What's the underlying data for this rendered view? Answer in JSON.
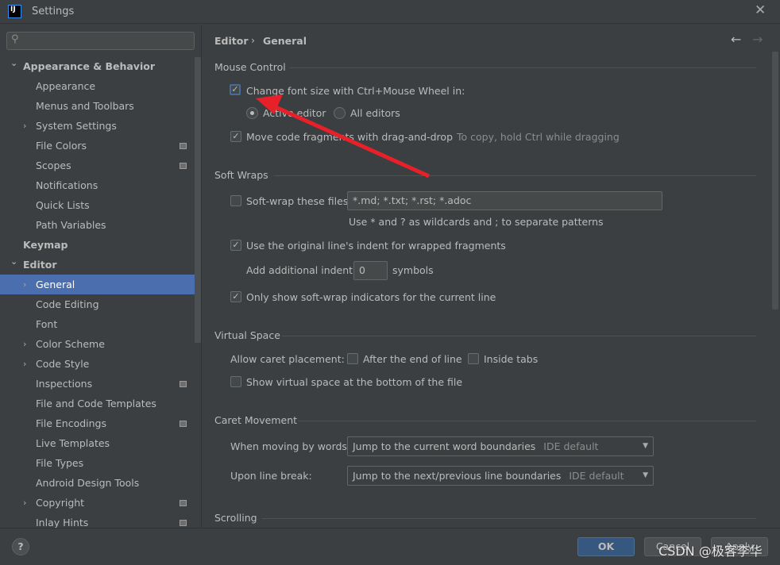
{
  "window": {
    "title": "Settings",
    "logo": "IJ",
    "close_icon": "close-icon"
  },
  "sidebar": {
    "search_placeholder": "",
    "items": [
      {
        "label": "Appearance & Behavior",
        "level": 0,
        "bold": true,
        "expanded": true
      },
      {
        "label": "Appearance",
        "level": 1
      },
      {
        "label": "Menus and Toolbars",
        "level": 1
      },
      {
        "label": "System Settings",
        "level": 1,
        "collapsed": true
      },
      {
        "label": "File Colors",
        "level": 1,
        "project_icon": true
      },
      {
        "label": "Scopes",
        "level": 1,
        "project_icon": true
      },
      {
        "label": "Notifications",
        "level": 1
      },
      {
        "label": "Quick Lists",
        "level": 1
      },
      {
        "label": "Path Variables",
        "level": 1
      },
      {
        "label": "Keymap",
        "level": 0,
        "bold": true
      },
      {
        "label": "Editor",
        "level": 0,
        "bold": true,
        "expanded": true
      },
      {
        "label": "General",
        "level": 1,
        "collapsed": true,
        "selected": true
      },
      {
        "label": "Code Editing",
        "level": 1
      },
      {
        "label": "Font",
        "level": 1
      },
      {
        "label": "Color Scheme",
        "level": 1,
        "collapsed": true
      },
      {
        "label": "Code Style",
        "level": 1,
        "collapsed": true
      },
      {
        "label": "Inspections",
        "level": 1,
        "project_icon": true
      },
      {
        "label": "File and Code Templates",
        "level": 1
      },
      {
        "label": "File Encodings",
        "level": 1,
        "project_icon": true
      },
      {
        "label": "Live Templates",
        "level": 1
      },
      {
        "label": "File Types",
        "level": 1
      },
      {
        "label": "Android Design Tools",
        "level": 1
      },
      {
        "label": "Copyright",
        "level": 1,
        "collapsed": true,
        "project_icon": true
      },
      {
        "label": "Inlay Hints",
        "level": 1,
        "project_icon": true
      }
    ]
  },
  "breadcrumb": {
    "parent": "Editor",
    "sep": "›",
    "current": "General",
    "back": "←",
    "forward": "→"
  },
  "mouse": {
    "title": "Mouse Control",
    "change_font": "Change font size with Ctrl+Mouse Wheel in:",
    "change_font_checked": true,
    "active_editor": "Active editor",
    "all_editors": "All editors",
    "selected_radio": "Active editor",
    "move_code": "Move code fragments with drag-and-drop",
    "move_code_checked": true,
    "move_hint": "To copy, hold Ctrl while dragging"
  },
  "softwraps": {
    "title": "Soft Wraps",
    "softwrap_files": "Soft-wrap these files:",
    "softwrap_checked": false,
    "patterns": "*.md; *.txt; *.rst; *.adoc",
    "patterns_hint": "Use * and ? as wildcards and ; to separate patterns",
    "original_indent": "Use the original line's indent for wrapped fragments",
    "original_indent_checked": true,
    "additional_indent": "Add additional indent:",
    "indent_value": "0",
    "symbols": "symbols",
    "only_current": "Only show soft-wrap indicators for the current line",
    "only_current_checked": true
  },
  "virtual": {
    "title": "Virtual Space",
    "allow_caret": "Allow caret placement:",
    "after_end": "After the end of line",
    "inside_tabs": "Inside tabs",
    "show_virtual": "Show virtual space at the bottom of the file"
  },
  "caret": {
    "title": "Caret Movement",
    "words_label": "When moving by words:",
    "words_value": "Jump to the current word boundaries",
    "words_hint": "IDE default",
    "line_label": "Upon line break:",
    "line_value": "Jump to the next/previous line boundaries",
    "line_hint": "IDE default"
  },
  "scrolling": {
    "title": "Scrolling"
  },
  "footer": {
    "help": "?",
    "ok": "OK",
    "cancel": "Cancel",
    "apply": "Apply"
  },
  "watermark": "CSDN @极客李华",
  "colors": {
    "selection": "#4b6eaf",
    "ok_button": "#365880",
    "annotation_arrow": "#e8202a"
  }
}
